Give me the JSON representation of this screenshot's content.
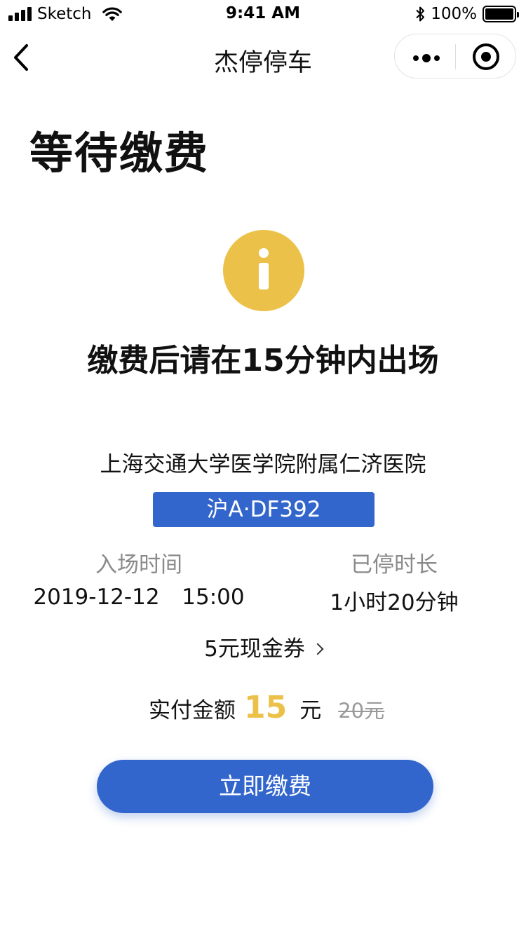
{
  "status_bar": {
    "carrier": "Sketch",
    "time": "9:41 AM",
    "battery_percent": "100%",
    "icons": [
      "signal-icon",
      "wifi-icon",
      "bluetooth-icon",
      "battery-icon"
    ]
  },
  "nav": {
    "title": "杰停停车",
    "icons": [
      "back-chevron-icon",
      "more-dots-icon",
      "close-target-icon"
    ]
  },
  "page": {
    "title": "等待缴费",
    "status_icon": "info-icon",
    "notice": "缴费后请在15分钟内出场"
  },
  "parking": {
    "lot_name": "上海交通大学医学院附属仁济医院",
    "plate": "沪A·DF392",
    "entry_time_label": "入场时间",
    "entry_time_value": "2019-12-12  15:00",
    "duration_label": "已停时长",
    "duration_value": "1小时20分钟"
  },
  "coupon": {
    "label": "5元现金券",
    "icon": "chevron-right-icon"
  },
  "payment": {
    "label": "实付金额",
    "amount": "15",
    "unit": "元",
    "original_price": "20元",
    "button_label": "立即缴费"
  },
  "colors": {
    "primary": "#3366cc",
    "accent_yellow": "#ecc14a",
    "muted_text": "#8a8a8a",
    "strikethrough_text": "#9a9a9a"
  }
}
